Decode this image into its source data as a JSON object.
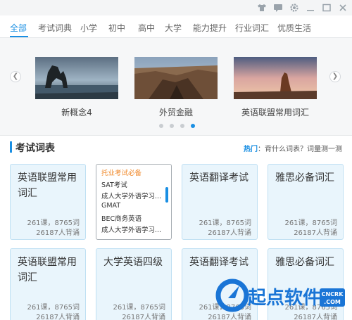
{
  "nav": {
    "tabs": [
      "全部",
      "考试词典",
      "小学",
      "初中",
      "高中",
      "大学",
      "能力提升",
      "行业词汇",
      "优质生活"
    ],
    "active_index": 0
  },
  "carousel": {
    "slides": [
      {
        "caption": "新概念4"
      },
      {
        "caption": "外贸金融"
      },
      {
        "caption": "英语联盟常用词汇"
      }
    ],
    "dots": 4,
    "active_dot": 3
  },
  "section": {
    "title": "考试词表",
    "hot_label": "热门",
    "hot_text": "：背什么词表？词量测一测"
  },
  "dropdown": {
    "items": [
      "托业考试必备",
      "SAT考试",
      "成人大学外语学习...",
      "GMAT",
      "BEC商务英语",
      "成人大学外语学习..."
    ]
  },
  "cards": [
    {
      "title": "英语联盟常用词汇",
      "info1": "261课，8765词",
      "info2": "26187人背诵"
    },
    {
      "title": "英语翻译考试",
      "info1": "261课，8765词",
      "info2": "26187人背诵"
    },
    {
      "title": "雅思必备词汇",
      "info1": "261课，8765词",
      "info2": "26187人背诵"
    },
    {
      "title": "英语联盟常用词汇",
      "info1": "261课，8765词",
      "info2": "26187人背诵"
    },
    {
      "title": "大学英语四级",
      "info1": "261课，8765词",
      "info2": "26187人背诵"
    },
    {
      "title": "英语翻译考试",
      "info1": "261课，8765词",
      "info2": "26187人背诵"
    },
    {
      "title": "雅思必备词汇",
      "info1": "261课，8765词",
      "info2": "26187人背诵"
    }
  ],
  "watermark": {
    "text": "起点软件",
    "badge_top": "CNCRK",
    "badge_bottom": ".COM"
  },
  "colors": {
    "accent": "#1a8fe3",
    "card_bg": "#e9f5fc",
    "highlight": "#f08a2c"
  }
}
